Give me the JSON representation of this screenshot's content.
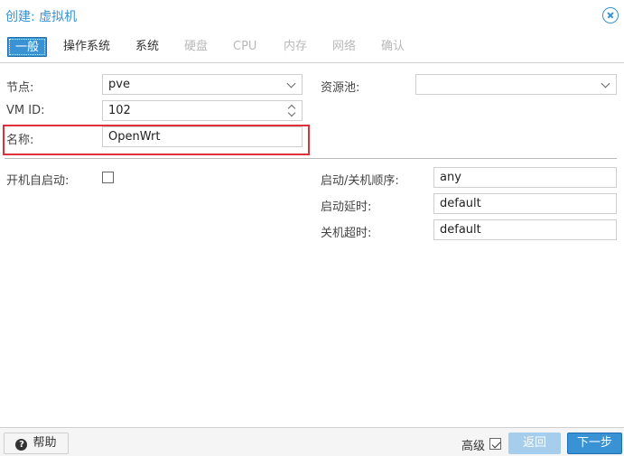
{
  "window": {
    "title": "创建: 虚拟机"
  },
  "tabs": [
    {
      "label": "一般",
      "state": "active"
    },
    {
      "label": "操作系统",
      "state": "enabled"
    },
    {
      "label": "系统",
      "state": "enabled"
    },
    {
      "label": "硬盘",
      "state": "disabled"
    },
    {
      "label": "CPU",
      "state": "disabled"
    },
    {
      "label": "内存",
      "state": "disabled"
    },
    {
      "label": "网络",
      "state": "disabled"
    },
    {
      "label": "确认",
      "state": "disabled"
    }
  ],
  "form": {
    "node": {
      "label": "节点:",
      "value": "pve"
    },
    "vmid": {
      "label": "VM ID:",
      "value": "102"
    },
    "name": {
      "label": "名称:",
      "value": "OpenWrt"
    },
    "pool": {
      "label": "资源池:",
      "value": ""
    },
    "onboot": {
      "label": "开机自启动:",
      "checked": false
    },
    "startup_order": {
      "label": "启动/关机顺序:",
      "value": "any"
    },
    "startup_delay": {
      "label": "启动延时:",
      "value": "default"
    },
    "shutdown_timeout": {
      "label": "关机超时:",
      "value": "default"
    }
  },
  "footer": {
    "help_label": "帮助",
    "advanced_label": "高级",
    "advanced_checked": true,
    "back_label": "返回",
    "next_label": "下一步"
  },
  "colors": {
    "accent": "#3892d4",
    "highlight": "#e0303a",
    "disabled_button": "#a6cdeb"
  },
  "icons": {
    "close": "close-circle-icon",
    "help": "question-circle-icon"
  }
}
